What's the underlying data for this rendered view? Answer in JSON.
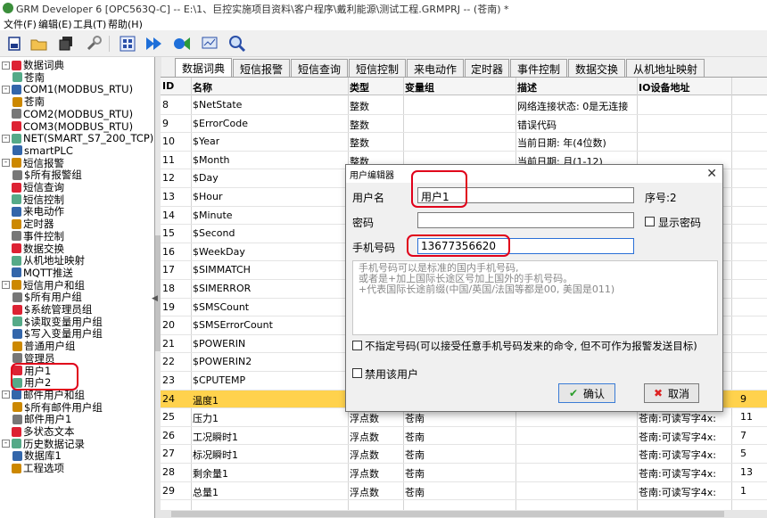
{
  "window": {
    "title": "GRM Developer 6 [OPC563Q-C] -- E:\\1、巨控实施项目资料\\客户程序\\戴利能源\\测试工程.GRMPRJ -- (苍南) *"
  },
  "menu": [
    "文件(F)",
    "编辑(E)",
    "工具(T)",
    "帮助(H)"
  ],
  "toolbar_icons": [
    "new-icon",
    "open-icon",
    "save-all-icon",
    "settings-icon",
    "compile-icon",
    "download-icon",
    "upload-icon",
    "monitor-icon",
    "search-icon"
  ],
  "tree": [
    {
      "label": "数据词典",
      "level": 0,
      "exp": "-"
    },
    {
      "label": "苍南",
      "level": 1,
      "exp": ""
    },
    {
      "label": "COM1(MODBUS_RTU)",
      "level": 0,
      "exp": "-"
    },
    {
      "label": "苍南",
      "level": 1,
      "exp": ""
    },
    {
      "label": "COM2(MODBUS_RTU)",
      "level": 0,
      "exp": ""
    },
    {
      "label": "COM3(MODBUS_RTU)",
      "level": 0,
      "exp": ""
    },
    {
      "label": "NET(SMART_S7_200_TCP)",
      "level": 0,
      "exp": "-"
    },
    {
      "label": "smartPLC",
      "level": 1,
      "exp": ""
    },
    {
      "label": "短信报警",
      "level": 0,
      "exp": "-"
    },
    {
      "label": "$所有报警组",
      "level": 1,
      "exp": ""
    },
    {
      "label": "短信查询",
      "level": 0,
      "exp": ""
    },
    {
      "label": "短信控制",
      "level": 0,
      "exp": ""
    },
    {
      "label": "来电动作",
      "level": 0,
      "exp": ""
    },
    {
      "label": "定时器",
      "level": 0,
      "exp": ""
    },
    {
      "label": "事件控制",
      "level": 0,
      "exp": ""
    },
    {
      "label": "数据交换",
      "level": 0,
      "exp": ""
    },
    {
      "label": "从机地址映射",
      "level": 0,
      "exp": ""
    },
    {
      "label": "MQTT推送",
      "level": 0,
      "exp": ""
    },
    {
      "label": "短信用户和组",
      "level": 0,
      "exp": "-"
    },
    {
      "label": "$所有用户组",
      "level": 1,
      "exp": ""
    },
    {
      "label": "$系统管理员组",
      "level": 1,
      "exp": ""
    },
    {
      "label": "$读取变量用户组",
      "level": 1,
      "exp": ""
    },
    {
      "label": "$写入变量用户组",
      "level": 1,
      "exp": ""
    },
    {
      "label": "普通用户组",
      "level": 1,
      "exp": ""
    },
    {
      "label": "管理员",
      "level": 1,
      "exp": ""
    },
    {
      "label": "用户1",
      "level": 1,
      "exp": ""
    },
    {
      "label": "用户2",
      "level": 1,
      "exp": ""
    },
    {
      "label": "邮件用户和组",
      "level": 0,
      "exp": "-"
    },
    {
      "label": "$所有邮件用户组",
      "level": 1,
      "exp": ""
    },
    {
      "label": "邮件用户1",
      "level": 1,
      "exp": ""
    },
    {
      "label": "多状态文本",
      "level": 0,
      "exp": ""
    },
    {
      "label": "历史数据记录",
      "level": 0,
      "exp": "-"
    },
    {
      "label": "数据库1",
      "level": 1,
      "exp": ""
    },
    {
      "label": "工程选项",
      "level": 0,
      "exp": ""
    }
  ],
  "tabs": [
    "数据词典",
    "短信报警",
    "短信查询",
    "短信控制",
    "来电动作",
    "定时器",
    "事件控制",
    "数据交换",
    "从机地址映射"
  ],
  "grid": {
    "columns": [
      "ID",
      "名称",
      "类型",
      "变量组",
      "描述",
      "IO设备地址"
    ],
    "rows": [
      [
        "8",
        "$NetState",
        "整数",
        "",
        "网络连接状态: 0是无连接",
        "",
        ""
      ],
      [
        "9",
        "$ErrorCode",
        "整数",
        "",
        "错误代码",
        "",
        ""
      ],
      [
        "10",
        "$Year",
        "整数",
        "",
        "当前日期: 年(4位数)",
        "",
        ""
      ],
      [
        "11",
        "$Month",
        "整数",
        "",
        "当前日期: 月(1-12)",
        "",
        ""
      ],
      [
        "12",
        "$Day",
        "",
        "",
        "",
        "",
        ""
      ],
      [
        "13",
        "$Hour",
        "",
        "",
        "",
        "",
        ""
      ],
      [
        "14",
        "$Minute",
        "",
        "",
        "",
        "",
        ""
      ],
      [
        "15",
        "$Second",
        "",
        "",
        "",
        "",
        ""
      ],
      [
        "16",
        "$WeekDay",
        "",
        "",
        "",
        "",
        ""
      ],
      [
        "17",
        "$SIMMATCH",
        "",
        "",
        "",
        "",
        ""
      ],
      [
        "18",
        "$SIMERROR",
        "",
        "",
        "",
        "",
        ""
      ],
      [
        "19",
        "$SMSCount",
        "",
        "",
        "",
        "",
        ""
      ],
      [
        "20",
        "$SMSErrorCount",
        "",
        "",
        "",
        "",
        ""
      ],
      [
        "21",
        "$POWERIN",
        "",
        "",
        "",
        "",
        ""
      ],
      [
        "22",
        "$POWERIN2",
        "",
        "",
        "",
        "",
        ""
      ],
      [
        "23",
        "$CPUTEMP",
        "",
        "",
        "",
        "",
        ""
      ],
      [
        "24",
        "温度1",
        "",
        "",
        "",
        "",
        "9"
      ],
      [
        "25",
        "压力1",
        "浮点数",
        "苍南",
        "",
        "苍南:可读写字4x:",
        "11"
      ],
      [
        "26",
        "工况瞬时1",
        "浮点数",
        "苍南",
        "",
        "苍南:可读写字4x:",
        "7"
      ],
      [
        "27",
        "标况瞬时1",
        "浮点数",
        "苍南",
        "",
        "苍南:可读写字4x:",
        "5"
      ],
      [
        "28",
        "剩余量1",
        "浮点数",
        "苍南",
        "",
        "苍南:可读写字4x:",
        "13"
      ],
      [
        "29",
        "总量1",
        "浮点数",
        "苍南",
        "",
        "苍南:可读写字4x:",
        "1"
      ]
    ],
    "selected_row": 16
  },
  "dialog": {
    "title": "用户编辑器",
    "username_label": "用户名",
    "username_value": "用户1",
    "seq_label": "序号:2",
    "password_label": "密码",
    "password_value": "",
    "show_password_label": "显示密码",
    "phone_label": "手机号码",
    "phone_value": "13677356620",
    "help_lines": [
      "手机号码可以是标准的国内手机号码,",
      "或者是+加上国际长途区号加上国外的手机号码。",
      "+代表国际长途前缀(中国/英国/法国等都是00, 美国是011)"
    ],
    "unspecified_label": "不指定号码(可以接受任意手机号码发来的命令, 但不可作为报警发送目标)",
    "disable_label": "禁用该用户",
    "ok_label": "确认",
    "cancel_label": "取消"
  }
}
